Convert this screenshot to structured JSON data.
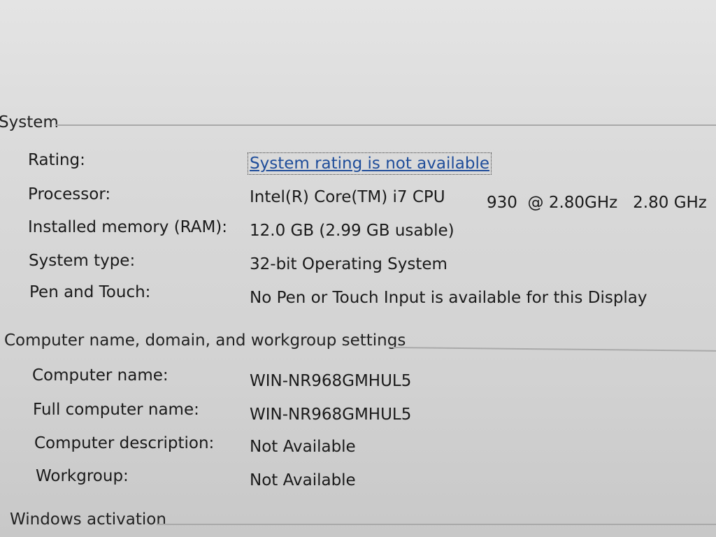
{
  "system": {
    "title": "System",
    "rows": [
      {
        "label": "Rating:",
        "value": "System rating is not available"
      },
      {
        "label": "Processor:",
        "value": "Intel(R) Core(TM) i7 CPU",
        "value_extra": "930  @ 2.80GHz   2.80 GHz"
      },
      {
        "label": "Installed memory (RAM):",
        "value": "12.0 GB (2.99 GB usable)"
      },
      {
        "label": "System type:",
        "value": "32-bit Operating System"
      },
      {
        "label": "Pen and Touch:",
        "value": "No Pen or Touch Input is available for this Display"
      }
    ]
  },
  "computer": {
    "title": "Computer name, domain, and workgroup settings",
    "rows": [
      {
        "label": "Computer name:",
        "value": "WIN-NR968GMHUL5"
      },
      {
        "label": "Full computer name:",
        "value": "WIN-NR968GMHUL5"
      },
      {
        "label": "Computer description:",
        "value": "Not Available"
      },
      {
        "label": "Workgroup:",
        "value": "Not Available"
      }
    ]
  },
  "activation": {
    "title": "Windows activation"
  }
}
